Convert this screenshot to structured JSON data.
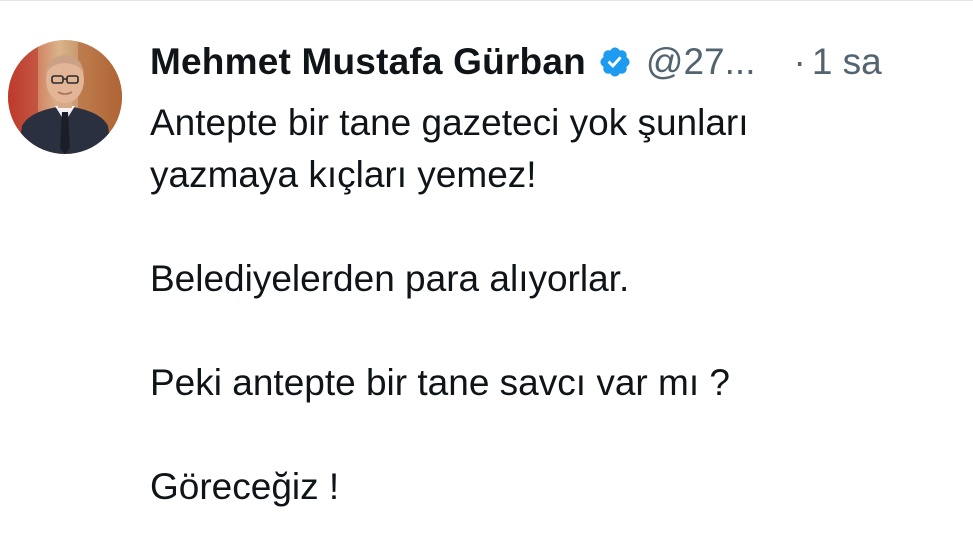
{
  "author": {
    "name": "Mehmet Mustafa Gürban",
    "handle": "@27...",
    "time_separator": "·",
    "time": "1 sa",
    "verified_badge_color": "#1d9bf0",
    "verified_icon": "verified-badge-icon"
  },
  "tweet": {
    "paragraphs": [
      [
        "Antepte bir tane gazeteci yok şunları",
        "yazmaya kıçları yemez!"
      ],
      [
        "Belediyelerden para alıyorlar."
      ],
      [
        "Peki antepte bir tane savcı var mı ?"
      ],
      [
        "Göreceğiz !"
      ]
    ]
  }
}
